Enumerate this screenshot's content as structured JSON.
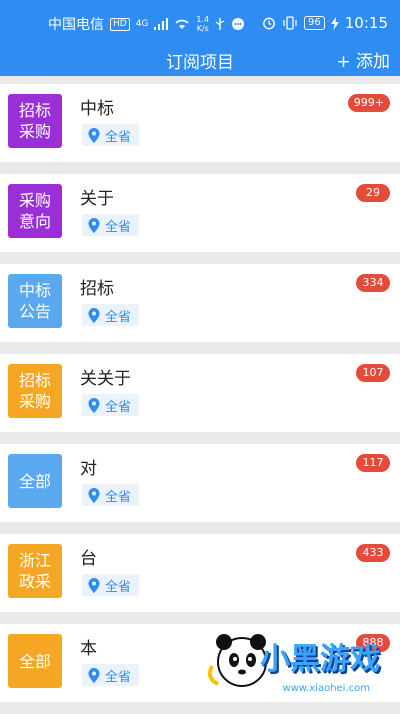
{
  "status_bar": {
    "carrier": "中国电信",
    "hd": "HD",
    "network": "4G",
    "speed_value": "1.4",
    "speed_unit": "K/s",
    "battery": "96",
    "time": "10:15"
  },
  "header": {
    "title": "订阅项目",
    "add_label": "+ 添加"
  },
  "colors": {
    "primary": "#2f8cf0",
    "purple": "#9a2fd8",
    "blue": "#5aa8f0",
    "orange": "#f5a623",
    "badge_red": "#e44b3a"
  },
  "subscriptions": [
    {
      "type_label": "招标\n采购",
      "type_color": "#9a2fd8",
      "keyword": "中标",
      "region": "全省",
      "count": "999+"
    },
    {
      "type_label": "采购\n意向",
      "type_color": "#9a2fd8",
      "keyword": "关于",
      "region": "全省",
      "count": "29"
    },
    {
      "type_label": "中标\n公告",
      "type_color": "#5aa8f0",
      "keyword": "招标",
      "region": "全省",
      "count": "334"
    },
    {
      "type_label": "招标\n采购",
      "type_color": "#f5a623",
      "keyword": "关关于",
      "region": "全省",
      "count": "107"
    },
    {
      "type_label": "全部",
      "type_color": "#5aa8f0",
      "keyword": "对",
      "region": "全省",
      "count": "117"
    },
    {
      "type_label": "浙江\n政采",
      "type_color": "#f5a623",
      "keyword": "台",
      "region": "全省",
      "count": "433"
    },
    {
      "type_label": "全部",
      "type_color": "#f5a623",
      "keyword": "本",
      "region": "全省",
      "count": "888"
    }
  ],
  "watermark": {
    "text": "小黑游戏",
    "url": "www.xiaohei.com"
  }
}
